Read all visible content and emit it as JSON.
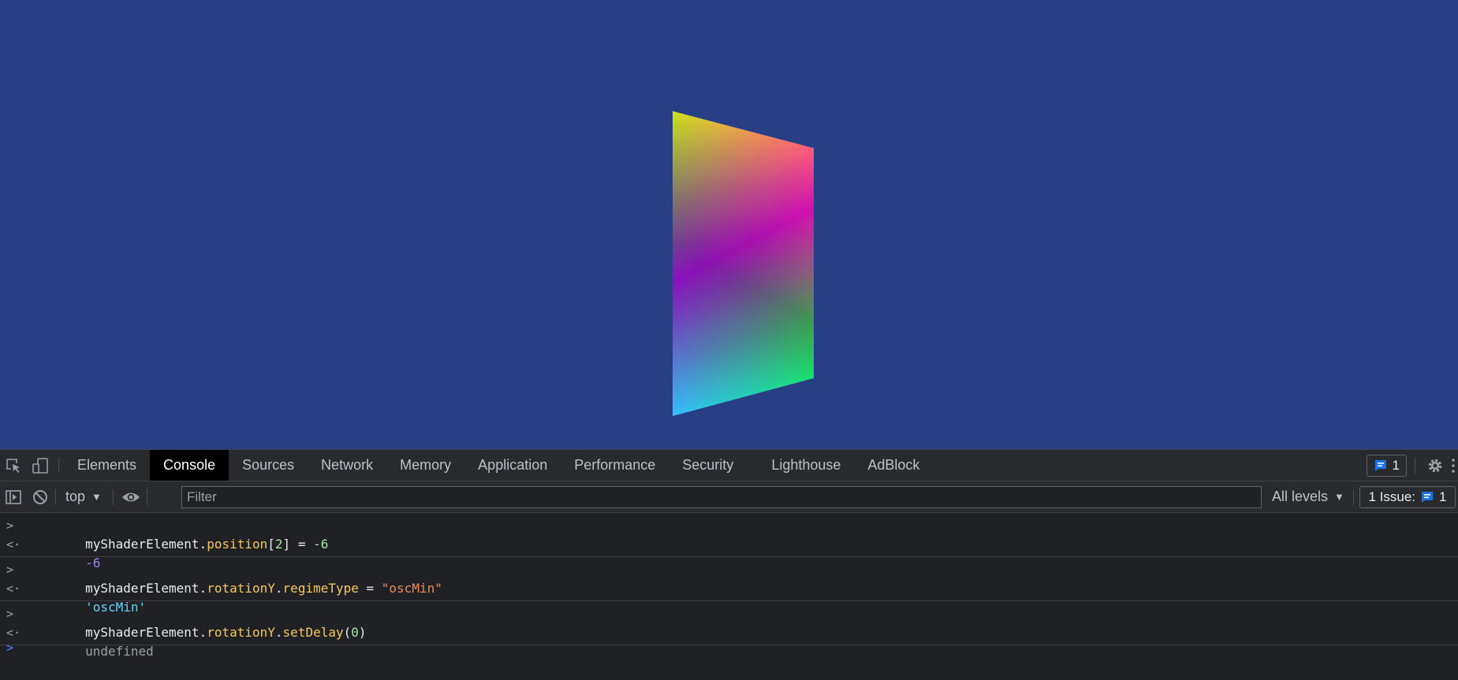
{
  "devtools": {
    "tabs": [
      "Elements",
      "Console",
      "Sources",
      "Network",
      "Memory",
      "Application",
      "Performance",
      "Security",
      "Lighthouse",
      "AdBlock"
    ],
    "active_tab": "Console",
    "issue_count": "1",
    "toolbar": {
      "context": "top",
      "filter_placeholder": "Filter",
      "levels": "All levels",
      "issues_label": "1 Issue:",
      "issues_count": "1"
    }
  },
  "console": {
    "entries": [
      {
        "input": {
          "object": "myShaderElement",
          "dot1": ".",
          "prop": "position",
          "open": "[",
          "index": "2",
          "close": "]",
          "op": " = ",
          "value": "-6"
        },
        "output": "-6"
      },
      {
        "input": {
          "object": "myShaderElement",
          "dot1": ".",
          "prop1": "rotationY",
          "dot2": ".",
          "prop2": "regimeType",
          "op": " = ",
          "value": "\"oscMin\""
        },
        "output": "'oscMin'"
      },
      {
        "input": {
          "object": "myShaderElement",
          "dot1": ".",
          "prop1": "rotationY",
          "dot2": ".",
          "prop2": "setDelay",
          "open": "(",
          "arg": "0",
          "close": ")"
        },
        "output": "undefined"
      }
    ]
  },
  "colors": {
    "canvas_bg": "#283f85",
    "devtools_bg": "#202124",
    "accent_blue": "#1a73e8"
  }
}
